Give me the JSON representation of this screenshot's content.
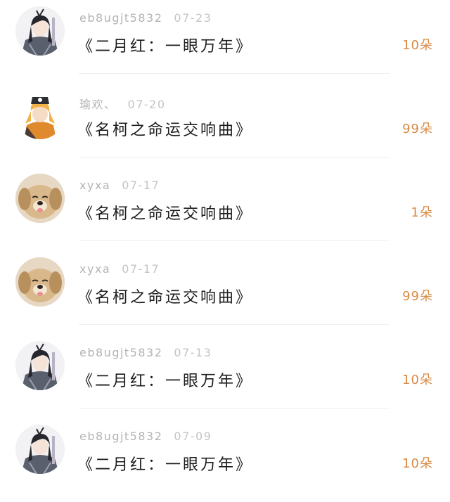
{
  "rows": [
    {
      "user": "eb8ugjt5832",
      "date": "07-23",
      "gift": "《二月红：一眼万年》",
      "count": "10朵",
      "avatar_icon": "anime-character-avatar"
    },
    {
      "user": "瑜欢、",
      "date": "07-20",
      "gift": "《名柯之命运交响曲》",
      "count": "99朵",
      "avatar_icon": "anime-character-avatar"
    },
    {
      "user": "xyxa",
      "date": "07-17",
      "gift": "《名柯之命运交响曲》",
      "count": "1朵",
      "avatar_icon": "puppy-avatar"
    },
    {
      "user": "xyxa",
      "date": "07-17",
      "gift": "《名柯之命运交响曲》",
      "count": "99朵",
      "avatar_icon": "puppy-avatar"
    },
    {
      "user": "eb8ugjt5832",
      "date": "07-13",
      "gift": "《二月红：一眼万年》",
      "count": "10朵",
      "avatar_icon": "anime-character-avatar"
    },
    {
      "user": "eb8ugjt5832",
      "date": "07-09",
      "gift": "《二月红：一眼万年》",
      "count": "10朵",
      "avatar_icon": "anime-character-avatar"
    }
  ],
  "colors": {
    "count": "#d98a45",
    "meta": "#b3b3b3",
    "title": "#1e1e1e"
  }
}
